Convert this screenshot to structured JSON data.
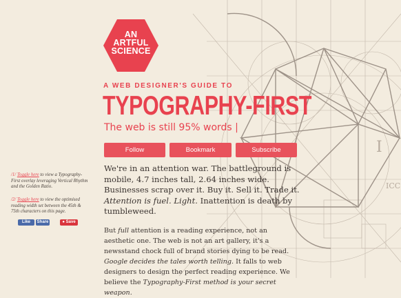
{
  "brand": {
    "logo_lines": [
      "AN",
      "ARTFUL",
      "SCIENCE"
    ],
    "accent_color": "#e8424f"
  },
  "hero": {
    "kicker": "A WEB DESIGNER'S GUIDE TO",
    "title": "TYPOGRAPHY-FIRST",
    "tagline": "The web is still 95% words |"
  },
  "actions": {
    "follow": "Follow",
    "bookmark": "Bookmark",
    "subscribe": "Subscribe"
  },
  "lead": {
    "part1": "We're in an attention war. The battleground is mobile, 4.7 inches tall, 2.64 inches wide. Businesses scrap over it. Buy it. Sell it. Trade it. ",
    "em1": "Attention is fuel. Light.",
    "part2": " Inattention is death by tumbleweed."
  },
  "body": {
    "p1": "But ",
    "em_full": "full",
    "p2": " attention is a reading experience, not an aesthetic one. The web is not an art gallery, it's a newsstand chock full of brand stories dying to be read. ",
    "em2": "Google decides the tales worth telling.",
    "p3": " It falls to web designers to design the perfect reading experience. We believe the ",
    "em3": "Typography-First method is your secret weapon."
  },
  "sidebar": {
    "note1": {
      "num": "/1/",
      "link": "Toggle here",
      "text": " to view a Typography-First overlay leveraging Vertical Rhythm and the Golden Ratio."
    },
    "note2": {
      "num": "/2/",
      "link": "Toggle here",
      "text": " to view the optimised reading width set between the 45th & 75th characters on this page."
    }
  },
  "share": {
    "like": "Like",
    "share": "Share",
    "save": "Save"
  },
  "colors": {
    "background": "#f3ecdf",
    "accent": "#e8424f",
    "button": "#e8525c",
    "facebook": "#4a6aa9",
    "pinterest": "#d9353d"
  }
}
